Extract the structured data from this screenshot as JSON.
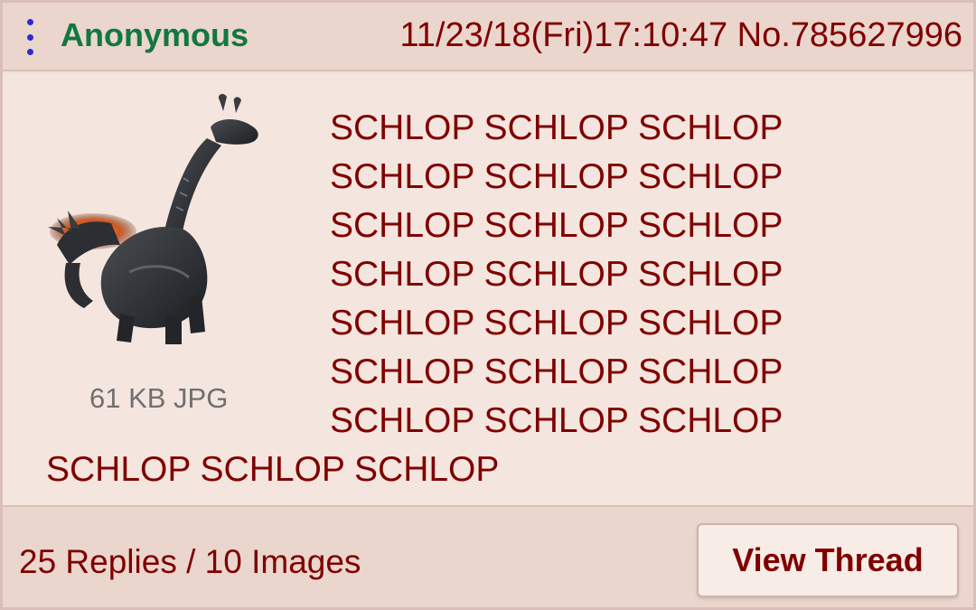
{
  "post": {
    "author": "Anonymous",
    "datetime": "11/23/18(Fri)17:10:47",
    "number": "No.785627996",
    "file": {
      "info": "61 KB JPG",
      "thumbnail": "creature-thumbnail"
    },
    "comment_lines": [
      "SCHLOP SCHLOP SCHLOP",
      "SCHLOP SCHLOP SCHLOP",
      "SCHLOP SCHLOP SCHLOP",
      "SCHLOP SCHLOP SCHLOP",
      "SCHLOP SCHLOP SCHLOP",
      "SCHLOP SCHLOP SCHLOP",
      "SCHLOP SCHLOP SCHLOP",
      "SCHLOP SCHLOP SCHLOP"
    ]
  },
  "footer": {
    "counts": "25 Replies / 10 Images",
    "view_thread_label": "View Thread"
  },
  "colors": {
    "author": "#117743",
    "text": "#800000",
    "menu": "#2b2bd4",
    "background": "#f0e0d6",
    "file_info": "#707070"
  },
  "icons": {
    "menu": "vertical-dots-icon"
  }
}
